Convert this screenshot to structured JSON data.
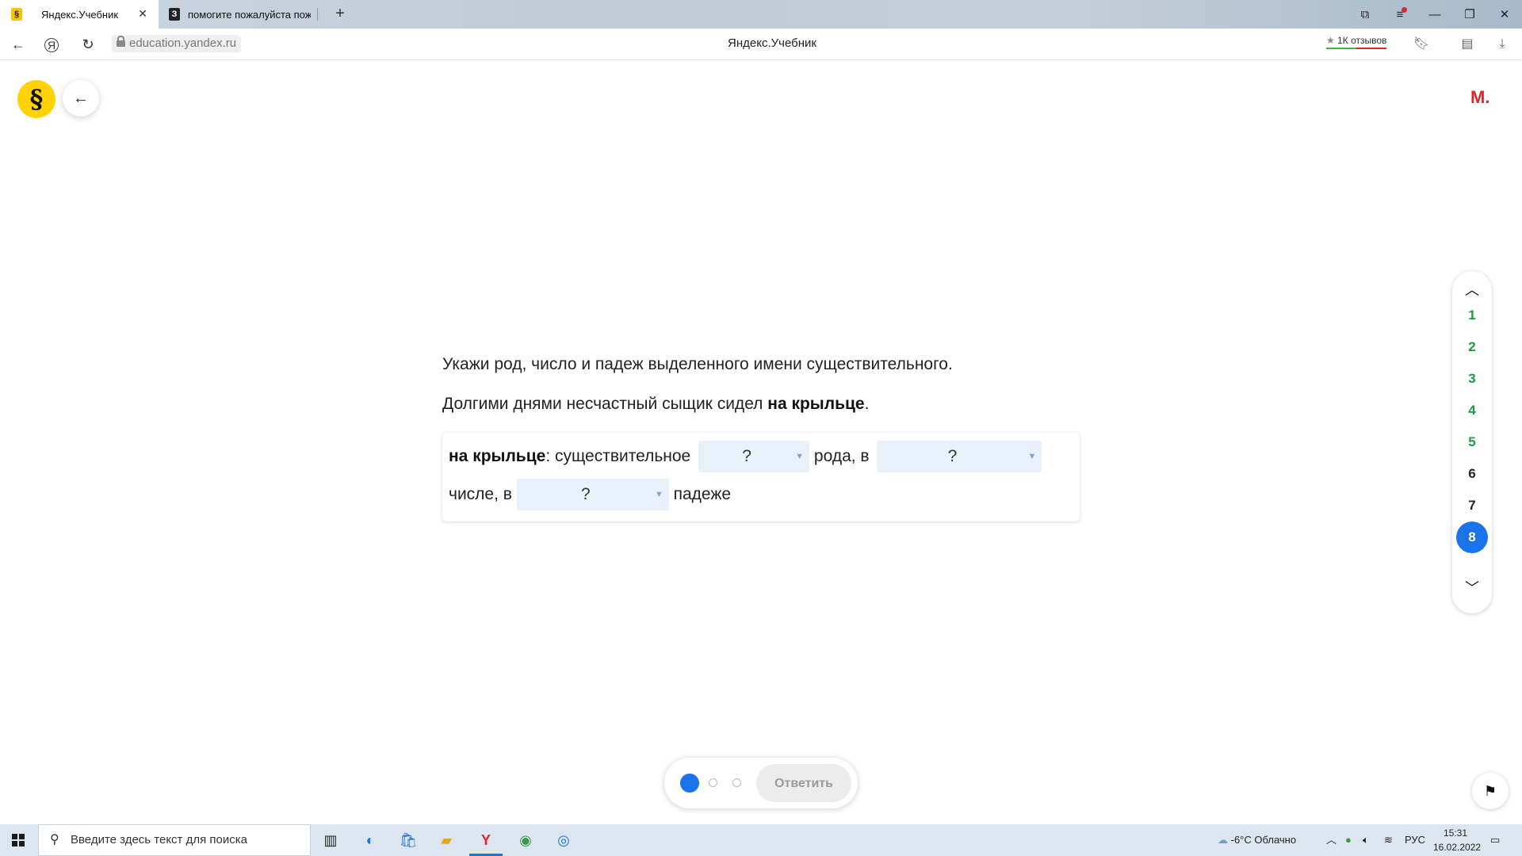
{
  "browser": {
    "tabs": [
      {
        "label": "Яндекс.Учебник",
        "favicon": "§",
        "active": true
      },
      {
        "label": "помогите пожалуйста пож",
        "favicon": "З",
        "active": false
      }
    ],
    "url": "education.yandex.ru",
    "page_title": "Яндекс.Учебник",
    "reviews_badge": "1К отзывов",
    "reviews_star": "★"
  },
  "header": {
    "logo_glyph": "§",
    "user_initial": "М."
  },
  "task": {
    "instruction": "Укажи род, число и падеж выделенного имени существительного.",
    "sentence_before": "Долгими днями несчастный сыщик сидел ",
    "sentence_bold": "на крыльце",
    "sentence_after": ".",
    "answer": {
      "lead_bold": "на крыльце",
      "lead_rest": ": существительное",
      "after_first": "рода, в",
      "line2_start": "числе, в",
      "after_third": "падеже",
      "selects": [
        {
          "name": "gender",
          "value": "?"
        },
        {
          "name": "number",
          "value": "?"
        },
        {
          "name": "case",
          "value": "?"
        }
      ]
    }
  },
  "question_nav": {
    "items": [
      {
        "label": "1",
        "status": "done"
      },
      {
        "label": "2",
        "status": "done"
      },
      {
        "label": "3",
        "status": "done"
      },
      {
        "label": "4",
        "status": "done"
      },
      {
        "label": "5",
        "status": "done"
      },
      {
        "label": "6",
        "status": "pending"
      },
      {
        "label": "7",
        "status": "pending"
      },
      {
        "label": "8",
        "status": "current"
      }
    ],
    "colors": {
      "done": "#1a9d3a",
      "current": "#1a73e8"
    }
  },
  "controls": {
    "submit_label": "Ответить",
    "attempts": {
      "total": 3,
      "current": 1
    }
  },
  "taskbar": {
    "search_placeholder": "Введите здесь текст для поиска",
    "weather": "-6°C  Облачно",
    "language": "РУС",
    "time": "15:31",
    "date": "16.02.2022"
  }
}
